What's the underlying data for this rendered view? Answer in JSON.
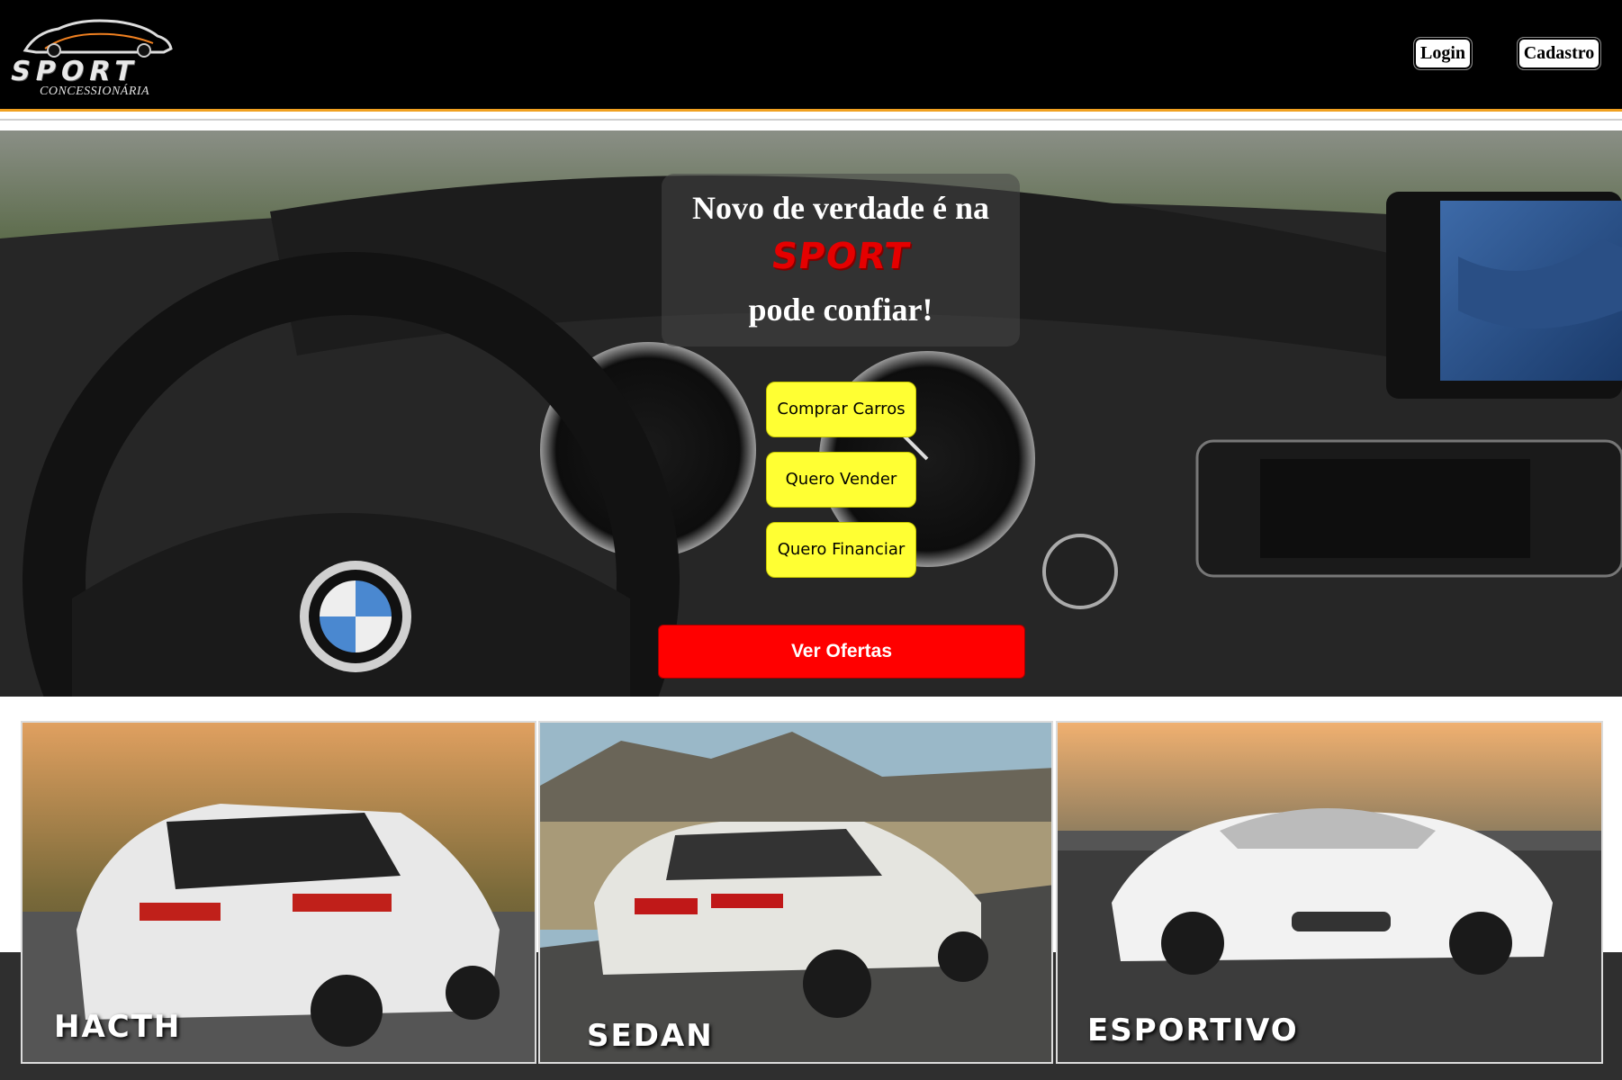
{
  "header": {
    "logo_text": "SPORT",
    "logo_subtitle": "CONCESSIONÁRIA",
    "login_label": "Login",
    "signup_label": "Cadastro"
  },
  "hero": {
    "headline_top": "Novo de verdade é na",
    "brand_word": "SPORT",
    "headline_bottom": "pode confiar!",
    "actions": [
      {
        "label": "Comprar Carros"
      },
      {
        "label": "Quero Vender"
      },
      {
        "label": "Quero Financiar"
      }
    ],
    "offers_label": "Ver Ofertas"
  },
  "categories": [
    {
      "label": "HACTH"
    },
    {
      "label": "SEDAN"
    },
    {
      "label": "ESPORTIVO"
    }
  ],
  "colors": {
    "header_bg": "#000000",
    "header_accent": "#f0a020",
    "action_button": "#ffff33",
    "offers_button": "#ff0000"
  }
}
